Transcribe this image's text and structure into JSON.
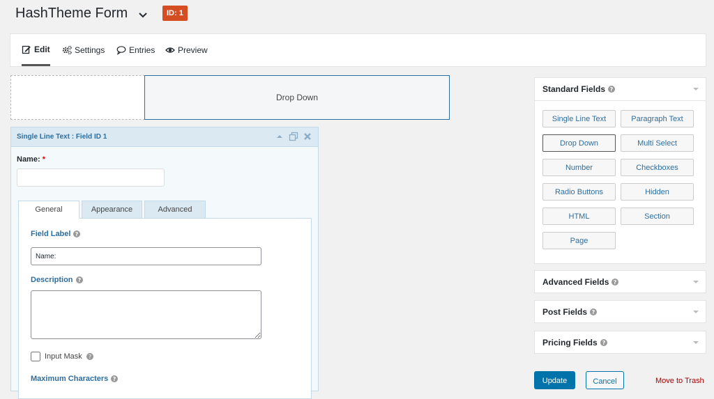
{
  "header": {
    "title": "HashTheme Form",
    "id_badge": "ID: 1"
  },
  "tabs": {
    "edit": "Edit",
    "settings": "Settings",
    "entries": "Entries",
    "preview": "Preview"
  },
  "canvas": {
    "drop_down_label": "Drop Down",
    "editor_title": "Single Line Text : Field ID 1",
    "name_label": "Name:",
    "name_required": "*",
    "settings_tabs": [
      "General",
      "Appearance",
      "Advanced"
    ],
    "field_label_title": "Field Label",
    "field_label_value": "Name:",
    "description_title": "Description",
    "input_mask_label": "Input Mask",
    "max_chars_label": "Maximum Characters"
  },
  "sidebar": {
    "standard_title": "Standard Fields",
    "standard_fields": [
      "Single Line Text",
      "Paragraph Text",
      "Drop Down",
      "Multi Select",
      "Number",
      "Checkboxes",
      "Radio Buttons",
      "Hidden",
      "HTML",
      "Section",
      "Page"
    ],
    "advanced_title": "Advanced Fields",
    "post_title": "Post Fields",
    "pricing_title": "Pricing Fields",
    "update_label": "Update",
    "cancel_label": "Cancel",
    "trash_label": "Move to Trash"
  },
  "colors": {
    "accent": "#2e6e9e",
    "badge": "#d54e21",
    "primary_button": "#0073aa"
  }
}
